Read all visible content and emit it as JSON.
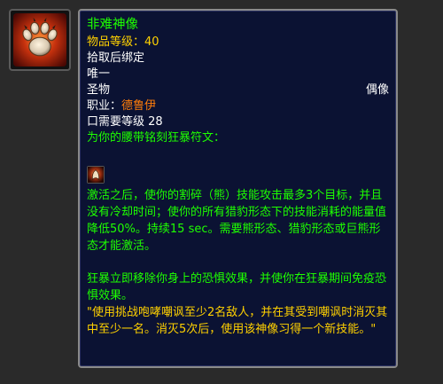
{
  "item": {
    "name": "非难神像",
    "item_level": "物品等级：40",
    "binding": "拾取后绑定",
    "unique": "唯一",
    "slot": "圣物",
    "type": "偶像",
    "class_label": "职业：",
    "class_value": "德鲁伊",
    "requires_level": "口需要等级 28",
    "engrave": "为你的腰带铭刻狂暴符文：",
    "effect_text": "激活之后，使你的割碎（熊）技能攻击最多3个目标，并且没有冷却时间；使你的所有猎豹形态下的技能消耗的能量值降低50%。持续15 sec。需要熊形态、猎豹形态或巨熊形态才能激活。",
    "effect_text2": "狂暴立即移除你身上的恐惧效果，并使你在狂暴期间免疫恐惧效果。",
    "flavor": "\"使用挑战咆哮嘲讽至少2名敌人，并在其受到嘲讽时消灭其中至少一名。消灭5次后，使用该神像习得一个新技能。\""
  },
  "colors": {
    "item_name": "#1eff00",
    "label_yellow": "#ffd100",
    "druid": "#ff7d0a",
    "tooltip_bg": "#0b1233",
    "border": "#8a8a8a"
  },
  "icons": {
    "item_icon": "paw-print-icon",
    "spell_icon": "berserk-rune-icon"
  }
}
